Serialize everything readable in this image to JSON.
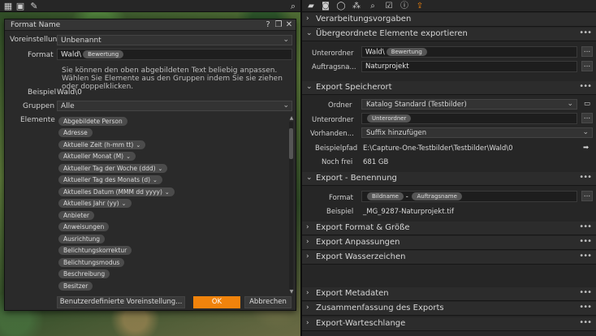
{
  "viewer": {
    "toolbar_icons": [
      "grid-icon",
      "display-icon",
      "pipette-icon",
      "search-icon"
    ]
  },
  "dialog": {
    "title": "Format Name",
    "help_btn": "?",
    "close_btn": "✕",
    "preset_label": "Voreinstellun",
    "preset_value": "Unbenannt",
    "format_label": "Format",
    "format_text": "Wald\\",
    "format_token": "Bewertung",
    "help_text": "Sie können den oben abgebildeten Text beliebig anpassen. Wählen Sie Elemente aus den Gruppen indem Sie sie ziehen oder doppelklicken.",
    "example_label": "Beispiel",
    "example_value": "Wald\\0",
    "groups_label": "Gruppen",
    "groups_value": "Alle",
    "elements_label": "Elemente",
    "elements": [
      {
        "label": "Abgebildete Person",
        "dropdown": false
      },
      {
        "label": "Adresse",
        "dropdown": false
      },
      {
        "label": "Aktuelle Zeit (h-mm tt)",
        "dropdown": true
      },
      {
        "label": "Aktueller Monat (M)",
        "dropdown": true
      },
      {
        "label": "Aktueller Tag der Woche (ddd)",
        "dropdown": true
      },
      {
        "label": "Aktueller Tag des Monats (d)",
        "dropdown": true
      },
      {
        "label": "Aktuelles Datum (MMM dd yyyy)",
        "dropdown": true
      },
      {
        "label": "Aktuelles Jahr (yy)",
        "dropdown": true
      },
      {
        "label": "Anbieter",
        "dropdown": false
      },
      {
        "label": "Anweisungen",
        "dropdown": false
      },
      {
        "label": "Ausrichtung",
        "dropdown": false
      },
      {
        "label": "Belichtungskorrektur",
        "dropdown": false
      },
      {
        "label": "Belichtungsmodus",
        "dropdown": false
      },
      {
        "label": "Beschreibung",
        "dropdown": false
      },
      {
        "label": "Besitzer",
        "dropdown": false
      }
    ],
    "btn_save_preset": "Benutzerdefinierte Voreinstellung...",
    "btn_ok": "OK",
    "btn_cancel": "Abbrechen"
  },
  "panel": {
    "tools": [
      "folder-icon",
      "camera-icon",
      "circle-icon",
      "color-icon",
      "search-icon",
      "check-icon",
      "info-icon",
      "export-icon"
    ],
    "sections": {
      "verarbeitung": "Verarbeitungsvorgaben",
      "uebergeordnete": "Übergeordnete Elemente exportieren",
      "speicherort": "Export Speicherort",
      "benennung": "Export - Benennung",
      "format": "Export Format & Größe",
      "anpassungen": "Export Anpassungen",
      "wasserzeichen": "Export Wasserzeichen",
      "metadaten": "Export Metadaten",
      "zusammenfassung": "Zusammenfassung des Exports",
      "warteschlange": "Export-Warteschlange"
    },
    "ue": {
      "unterordner_label": "Unterordner",
      "unterordner_text": "Wald\\",
      "unterordner_token": "Bewertung",
      "auftrag_label": "Auftragsna...",
      "auftrag_value": "Naturprojekt"
    },
    "sp": {
      "ordner_label": "Ordner",
      "ordner_value": "Katalog Standard (Testbilder)",
      "unterordner_label": "Unterordner",
      "unterordner_token": "Unterordner",
      "vorhanden_label": "Vorhanden...",
      "vorhanden_value": "Suffix hinzufügen",
      "beispielpfad_label": "Beispielpfad",
      "beispielpfad_value": "E:\\Capture-One-Testbilder\\Testbilder\\Wald\\0",
      "frei_label": "Noch frei",
      "frei_value": "681 GB"
    },
    "bn": {
      "format_label": "Format",
      "token1": "Bildname",
      "sep": "-",
      "token2": "Auftragsname",
      "beispiel_label": "Beispiel",
      "beispiel_value": "_MG_9287-Naturprojekt.tif"
    },
    "ellipsis": "...",
    "dots": "•••"
  },
  "colors": {
    "accent": "#f0830c",
    "panel_bg": "#262626",
    "dialog_bg": "#2a2a2a"
  }
}
